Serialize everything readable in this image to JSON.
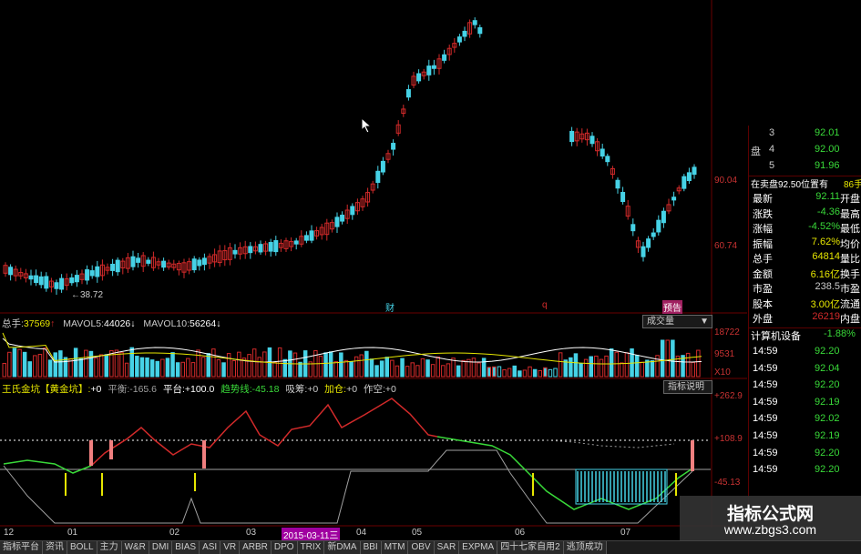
{
  "colors": {
    "up": "#d22a2a",
    "down": "#46d2e6",
    "axis_frame": "#6a0000",
    "yellow": "#e6e600",
    "green": "#39d939",
    "white": "#ffffff",
    "gray": "#a0a0a0"
  },
  "price_axis": {
    "labels": [
      "90.04",
      "60.74"
    ]
  },
  "low_marker": "←38.72",
  "event_markers": [
    "财",
    "q",
    "预告"
  ],
  "volume_header": {
    "total_label": "总手:",
    "total_value": "37569",
    "ma5_label": "MAVOL5:",
    "ma5_value": "44026",
    "ma10_label": "MAVOL10:",
    "ma10_value": "56264",
    "up_arrow": "↑",
    "down_arrow": "↓"
  },
  "volume_button": "成交量",
  "volume_axis": {
    "labels": [
      "18722",
      "9531",
      "X10"
    ]
  },
  "indicator_header": {
    "name": "王氏金坑【黄金坑】:",
    "name_val": "+0",
    "pingheng_label": "平衡:",
    "pingheng_val": "-165.6",
    "pingtai_label": "平台:",
    "pingtai_val": "+100.0",
    "trend_label": "趋势线:",
    "trend_val": "-45.18",
    "xichou_label": "吸筹:",
    "xichou_val": "+0",
    "jiacang_label": "加仓:",
    "jiacang_val": "+0",
    "zuokong_label": "作空:",
    "zuokong_val": "+0"
  },
  "indicator_button": "指标说明",
  "indicator_axis": {
    "labels": [
      "+262.9",
      "+108.9",
      "-45.13"
    ]
  },
  "months": [
    "12",
    "01",
    "02",
    "03",
    "2015-03-11三",
    "04",
    "05",
    "06",
    "07"
  ],
  "tabs": [
    "指标平台",
    "资讯",
    "BOLL",
    "主力",
    "W&R",
    "DMI",
    "BIAS",
    "ASI",
    "VR",
    "ARBR",
    "DPO",
    "TRIX",
    "新DMA",
    "BBI",
    "MTM",
    "OBV",
    "SAR",
    "EXPMA",
    "四十七家自用2",
    "逃顶成功"
  ],
  "right_panel": {
    "order_rows": [
      {
        "left": "",
        "idx": "3",
        "price": "92.01"
      },
      {
        "left": "盘",
        "idx": "4",
        "price": "92.00"
      },
      {
        "left": "",
        "idx": "5",
        "price": "91.96"
      }
    ],
    "on_sale_text": "在卖盘92.50位置有",
    "on_sale_val": "86手",
    "stats": [
      {
        "label": "最新",
        "value": "92.11",
        "tail": "开盘"
      },
      {
        "label": "涨跌",
        "value": "-4.36",
        "tail": "最高"
      },
      {
        "label": "涨幅",
        "value": "-4.52%",
        "tail": "最低"
      },
      {
        "label": "振幅",
        "value": "7.62%",
        "tail": "均价"
      },
      {
        "label": "总手",
        "value": "64814",
        "tail": "量比"
      },
      {
        "label": "金额",
        "value": "6.16亿",
        "tail": "换手"
      },
      {
        "label": "市盈",
        "value": "238.5",
        "tail": "市盈"
      },
      {
        "label": "股本",
        "value": "3.00亿",
        "tail": "流通"
      },
      {
        "label": "外盘",
        "value": "26219",
        "tail": "内盘"
      }
    ],
    "sector_label": "计算机设备",
    "sector_value": "-1.88%",
    "ticks": [
      {
        "time": "14:59",
        "price": "92.20"
      },
      {
        "time": "14:59",
        "price": "92.04"
      },
      {
        "time": "14:59",
        "price": "92.20"
      },
      {
        "time": "14:59",
        "price": "92.19"
      },
      {
        "time": "14:59",
        "price": "92.02"
      },
      {
        "time": "14:59",
        "price": "92.19"
      },
      {
        "time": "14:59",
        "price": "92.20"
      },
      {
        "time": "14:59",
        "price": "92.20"
      }
    ]
  },
  "watermark": {
    "title": "指标公式网",
    "url": "www.zbgs3.com"
  }
}
